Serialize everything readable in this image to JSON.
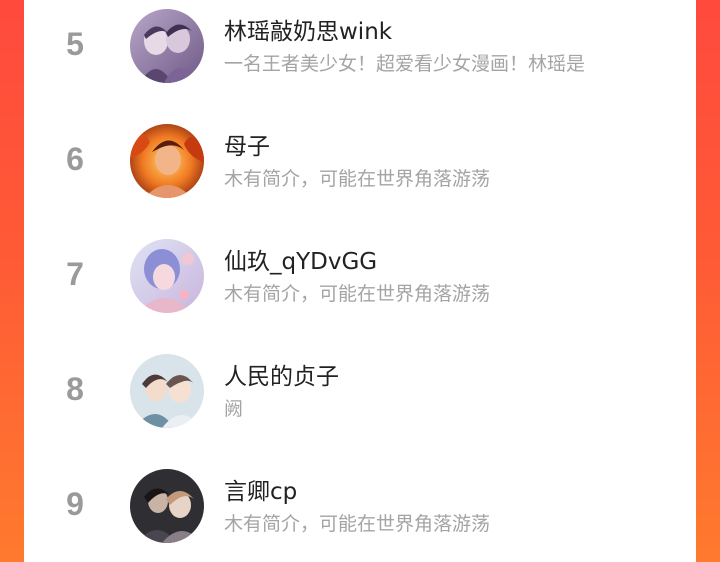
{
  "ranking": {
    "rows": [
      {
        "rank": "5",
        "name": "林瑶敲奶思wink",
        "intro": "一名王者美少女！超爱看少女漫画！林瑶是",
        "avatar_icon": "purple-couple-avatar-icon"
      },
      {
        "rank": "6",
        "name": "母子",
        "intro": "木有简介，可能在世界角落游荡",
        "avatar_icon": "flame-warrior-avatar-icon"
      },
      {
        "rank": "7",
        "name": "仙玖_qYDvGG",
        "intro": "木有简介，可能在世界角落游荡",
        "avatar_icon": "pastel-girl-avatar-icon"
      },
      {
        "rank": "8",
        "name": "人民的贞子",
        "intro": "阙",
        "avatar_icon": "anime-couple-avatar-icon"
      },
      {
        "rank": "9",
        "name": "言卿cp",
        "intro": "木有简介，可能在世界角落游荡",
        "avatar_icon": "dark-couple-avatar-icon"
      }
    ]
  },
  "colors": {
    "background_gradient_top": "#ff4a3d",
    "background_gradient_bottom": "#ff7a2e",
    "rank_number": "#9a9a9a",
    "name_text": "#222222",
    "intro_text": "#a4a4a4"
  }
}
